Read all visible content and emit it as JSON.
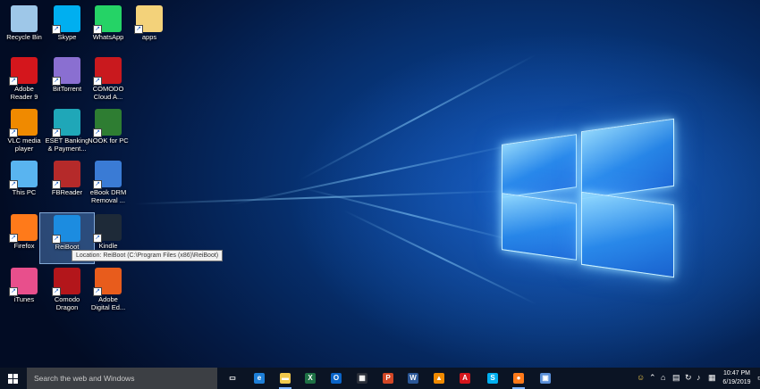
{
  "desktop_icons": [
    {
      "label": "Recycle Bin",
      "icon": "recycle-bin-icon",
      "color": "#9ec7e8"
    },
    {
      "label": "Skype",
      "icon": "skype-icon",
      "color": "#00aff0"
    },
    {
      "label": "WhatsApp",
      "icon": "whatsapp-icon",
      "color": "#25d366"
    },
    {
      "label": "apps",
      "icon": "folder-icon",
      "color": "#f3d27a"
    },
    {
      "label": "Adobe\nReader 9",
      "icon": "adobe-reader-icon",
      "color": "#d4161c"
    },
    {
      "label": "BitTorrent",
      "icon": "bittorrent-icon",
      "color": "#8a6fd1"
    },
    {
      "label": "COMODO\nCloud A...",
      "icon": "comodo-cloud-icon",
      "color": "#c9191e"
    },
    {
      "label": "VLC media\nplayer",
      "icon": "vlc-icon",
      "color": "#f08a00"
    },
    {
      "label": "ESET Banking\n& Payment...",
      "icon": "eset-banking-icon",
      "color": "#1fa7b8"
    },
    {
      "label": "NOOK for PC",
      "icon": "nook-icon",
      "color": "#2e7d32"
    },
    {
      "label": "This PC",
      "icon": "this-pc-icon",
      "color": "#59b4f0"
    },
    {
      "label": "FBReader",
      "icon": "fbreader-icon",
      "color": "#b52a2a"
    },
    {
      "label": "eBook DRM\nRemoval ...",
      "icon": "ebook-drm-icon",
      "color": "#3a7bd5"
    },
    {
      "label": "Firefox",
      "icon": "firefox-icon",
      "color": "#ff7a1a"
    },
    {
      "label": "ReiBoot",
      "icon": "reiboot-icon",
      "color": "#1c8ce0"
    },
    {
      "label": "Kindle",
      "icon": "kindle-icon",
      "color": "#1e2a38"
    },
    {
      "label": "iTunes",
      "icon": "itunes-icon",
      "color": "#e84f8c"
    },
    {
      "label": "Comodo\nDragon",
      "icon": "comodo-dragon-icon",
      "color": "#b3161b"
    },
    {
      "label": "Adobe\nDigital Ed...",
      "icon": "adobe-digital-editions-icon",
      "color": "#e85c1c"
    }
  ],
  "tooltip": {
    "text": "Location: ReiBoot (C:\\Program Files (x86)\\ReiBoot)"
  },
  "taskbar": {
    "search_placeholder": "Search the web and Windows",
    "apps": [
      {
        "icon": "task-view-icon",
        "glyph": "▭",
        "color": "#0b1424"
      },
      {
        "icon": "edge-icon",
        "glyph": "e",
        "color": "#1e7fd8"
      },
      {
        "icon": "file-explorer-icon",
        "glyph": "▬",
        "color": "#f2c94c"
      },
      {
        "icon": "excel-icon",
        "glyph": "X",
        "color": "#1e7145"
      },
      {
        "icon": "outlook-icon",
        "glyph": "O",
        "color": "#0a64c8"
      },
      {
        "icon": "store-icon",
        "glyph": "▦",
        "color": "#2a2f3a"
      },
      {
        "icon": "powerpoint-icon",
        "glyph": "P",
        "color": "#d24726"
      },
      {
        "icon": "word-icon",
        "glyph": "W",
        "color": "#2b5797"
      },
      {
        "icon": "vlc-taskbar-icon",
        "glyph": "▲",
        "color": "#f08a00"
      },
      {
        "icon": "adobe-taskbar-icon",
        "glyph": "A",
        "color": "#d4161c"
      },
      {
        "icon": "skype-taskbar-icon",
        "glyph": "S",
        "color": "#00aff0"
      },
      {
        "icon": "firefox-taskbar-icon",
        "glyph": "●",
        "color": "#ff7a1a"
      },
      {
        "icon": "network-app-icon",
        "glyph": "▣",
        "color": "#5a8fd8"
      }
    ],
    "tray": {
      "time": "10:47 PM",
      "date": "6/19/2019"
    }
  }
}
